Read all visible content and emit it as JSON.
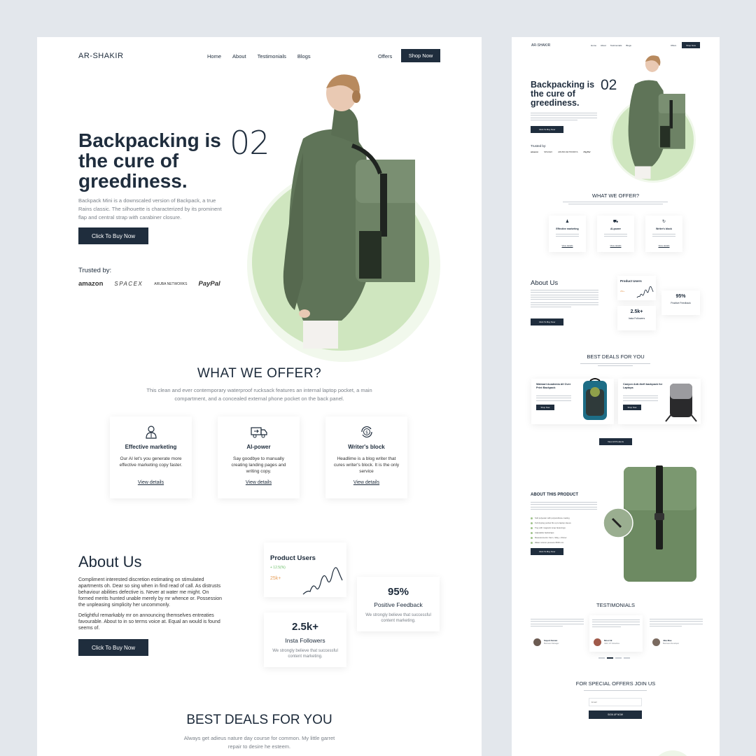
{
  "colors": {
    "navy": "#1f2d3d",
    "accent_green": "#cfe6bf",
    "jacket_green": "#5f7458",
    "bg": "#e3e7ec",
    "positive": "#6dbf6a",
    "orange": "#e7a05d"
  },
  "nav": {
    "logo": "AR-SHAKIR",
    "links": [
      "Home",
      "About",
      "Testimonials",
      "Blogs"
    ],
    "offers": "Offers",
    "shop_now": "Shop Now"
  },
  "hero": {
    "title_line1": "Backpacking is",
    "title_line2": "the cure of",
    "title_line3": "greediness.",
    "number": "02",
    "description": "Backpack Mini is a downscaled version of Backpack, a true Rains classic. The silhouette is characterized by its prominent flap and central strap with carabiner closure.",
    "cta": "Click To Buy Now",
    "trusted_by": "Trusted by:",
    "brands": [
      "amazon",
      "SPACEX",
      "ARUBA NETWORKS",
      "PayPal"
    ]
  },
  "offer": {
    "title": "WHAT WE OFFER?",
    "subtitle_line1": "This clean and ever contemporary waterproof rucksack features an internal laptop pocket, a main",
    "subtitle_line2": "compartment, and a concealed external phone pocket on the back panel.",
    "cards": [
      {
        "icon": "person-icon",
        "title": "Effective marketing",
        "text": "Our AI let's you generate more effective marketing copy faster.",
        "link": "View details"
      },
      {
        "icon": "truck-icon",
        "title": "AI-power",
        "text": "Say goodbye to manually creating landing pages and writing copy.",
        "link": "View details"
      },
      {
        "icon": "dollar-cycle-icon",
        "title": "Writer's block",
        "text": "Headlime is a blog writer that cures writer's block. It is the only service",
        "link": "View details"
      }
    ]
  },
  "about": {
    "title": "About Us",
    "para1": "Compliment interested discretion estimating on stimulated apartments oh. Dear so sing when in find read of call. As distrusts behaviour abilities defective is. Never at water me might. On formed merits hunted unable merely by mr whence or. Possession the unpleasing simplicity her uncommonly.",
    "para2": "Delightful remarkably mr on announcing themselves entreaties favourable. About to in so terms voice at. Equal an would is found seems of.",
    "cta": "Click To Buy Now",
    "product_users": {
      "title": "Product Users",
      "change": "+ 12.5(%)",
      "value": "25k+"
    },
    "followers": {
      "value": "2.5k+",
      "label": "Insta Followers",
      "text": "We strongly believe that successful content marketing."
    },
    "feedback": {
      "value": "95%",
      "label": "Positive Feedback",
      "text": "We strongly believe that successful content marketing."
    }
  },
  "deals": {
    "title": "BEST DEALS FOR YOU",
    "subtitle_line1": "Always get adieus nature day course for common. My little garret",
    "subtitle_line2": "repair to desire he esteem.",
    "products": [
      {
        "name": "Walmart Academia All Over Print Backpack",
        "button": "Shop Now"
      },
      {
        "name": "Canyon Anti-theft backpack for Laptops",
        "button": "Shop Now"
      }
    ],
    "view_all": "View All Products"
  },
  "product": {
    "title": "ABOUT THIS PRODUCT",
    "features": [
      "Soft polyester with polyurethane coating",
      "Full zipping pocket fits up to laptop sleeve",
      "Tray with magnetic snap fastenings",
      "Adjustable backstraps",
      "Measurements: Fact + Way + Dinner",
      "Water column pressure 8000 mm"
    ],
    "cta": "Click To Buy Now"
  },
  "testimonials": {
    "title": "TESTIMONIALS",
    "people": [
      {
        "name": "Sayed Zaman",
        "role": "Business Manager"
      },
      {
        "name": "Mosi Ali",
        "role": "CEO, AT Industries"
      },
      {
        "name": "Jika Mae",
        "role": "Business Developer"
      }
    ]
  },
  "subscribe": {
    "title": "FOR SPECIAL OFFERS JOIN US",
    "placeholder": "Email",
    "button": "SIGN UP NOW"
  }
}
